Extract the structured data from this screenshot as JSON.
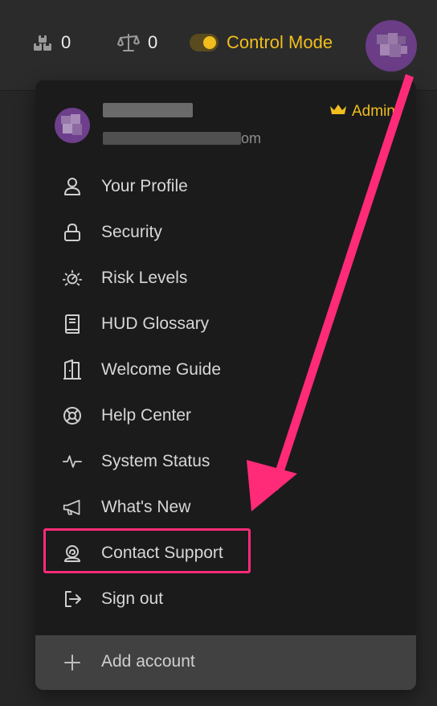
{
  "topbar": {
    "stat1": {
      "value": "0",
      "icon": "blocks-icon"
    },
    "stat2": {
      "value": "0",
      "icon": "scale-icon"
    },
    "control_mode": {
      "label": "Control Mode",
      "enabled": true,
      "accent": "#f1be1e"
    }
  },
  "account": {
    "email_suffix": "om",
    "role": "Admin"
  },
  "menu": {
    "items": [
      {
        "id": "profile",
        "label": "Your Profile",
        "icon": "user-icon"
      },
      {
        "id": "security",
        "label": "Security",
        "icon": "lock-icon"
      },
      {
        "id": "risk-levels",
        "label": "Risk Levels",
        "icon": "risk-icon"
      },
      {
        "id": "hud-glossary",
        "label": "HUD Glossary",
        "icon": "book-icon"
      },
      {
        "id": "welcome-guide",
        "label": "Welcome Guide",
        "icon": "door-icon"
      },
      {
        "id": "help-center",
        "label": "Help Center",
        "icon": "lifebuoy-icon"
      },
      {
        "id": "system-status",
        "label": "System Status",
        "icon": "pulse-icon"
      },
      {
        "id": "whats-new",
        "label": "What's New",
        "icon": "megaphone-icon"
      },
      {
        "id": "contact-support",
        "label": "Contact Support",
        "icon": "headset-icon"
      },
      {
        "id": "sign-out",
        "label": "Sign out",
        "icon": "logout-icon"
      }
    ],
    "add_account": {
      "label": "Add account",
      "icon": "plus-icon"
    }
  },
  "annotation": {
    "highlighted_item": "Contact Support",
    "color": "#ff2b78"
  }
}
